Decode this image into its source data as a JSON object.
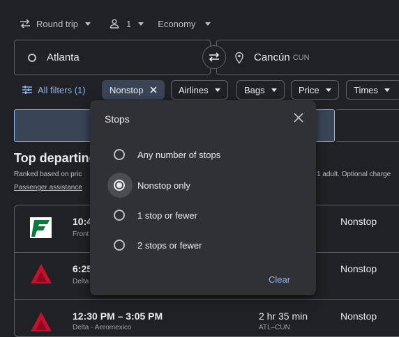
{
  "trip": {
    "type_label": "Round trip",
    "passengers": "1",
    "cabin": "Economy"
  },
  "origin": {
    "value": "Atlanta"
  },
  "destination": {
    "value": "Cancún",
    "code": "CUN"
  },
  "filters": {
    "all_label": "All filters (1)",
    "chips": {
      "nonstop": "Nonstop",
      "airlines": "Airlines",
      "bags": "Bags",
      "price": "Price",
      "times": "Times"
    }
  },
  "background": {
    "section_title": "Top departing",
    "ranked_text": "Ranked based on pric",
    "right_note": "1 adult. Optional charge",
    "assistance_link": "Passenger assistance"
  },
  "flights": [
    {
      "time": "10:4",
      "airline": "Front",
      "stops": "Nonstop"
    },
    {
      "time": "6:25",
      "airline": "Delta",
      "stops": "Nonstop"
    },
    {
      "time": "12:30 PM – 3:05 PM",
      "airline": "Delta · Aeromexico",
      "duration": "2 hr 35 min",
      "route": "ATL–CUN",
      "stops": "Nonstop"
    }
  ],
  "stops_popup": {
    "title": "Stops",
    "options": [
      "Any number of stops",
      "Nonstop only",
      "1 stop or fewer",
      "2 stops or fewer"
    ],
    "selected": "Nonstop only",
    "clear_label": "Clear"
  },
  "colors": {
    "accent": "#8ab4f8",
    "background": "#202124",
    "popup": "#303134",
    "frontier_green": "#0b7a3b",
    "delta_red": "#c8102e"
  }
}
